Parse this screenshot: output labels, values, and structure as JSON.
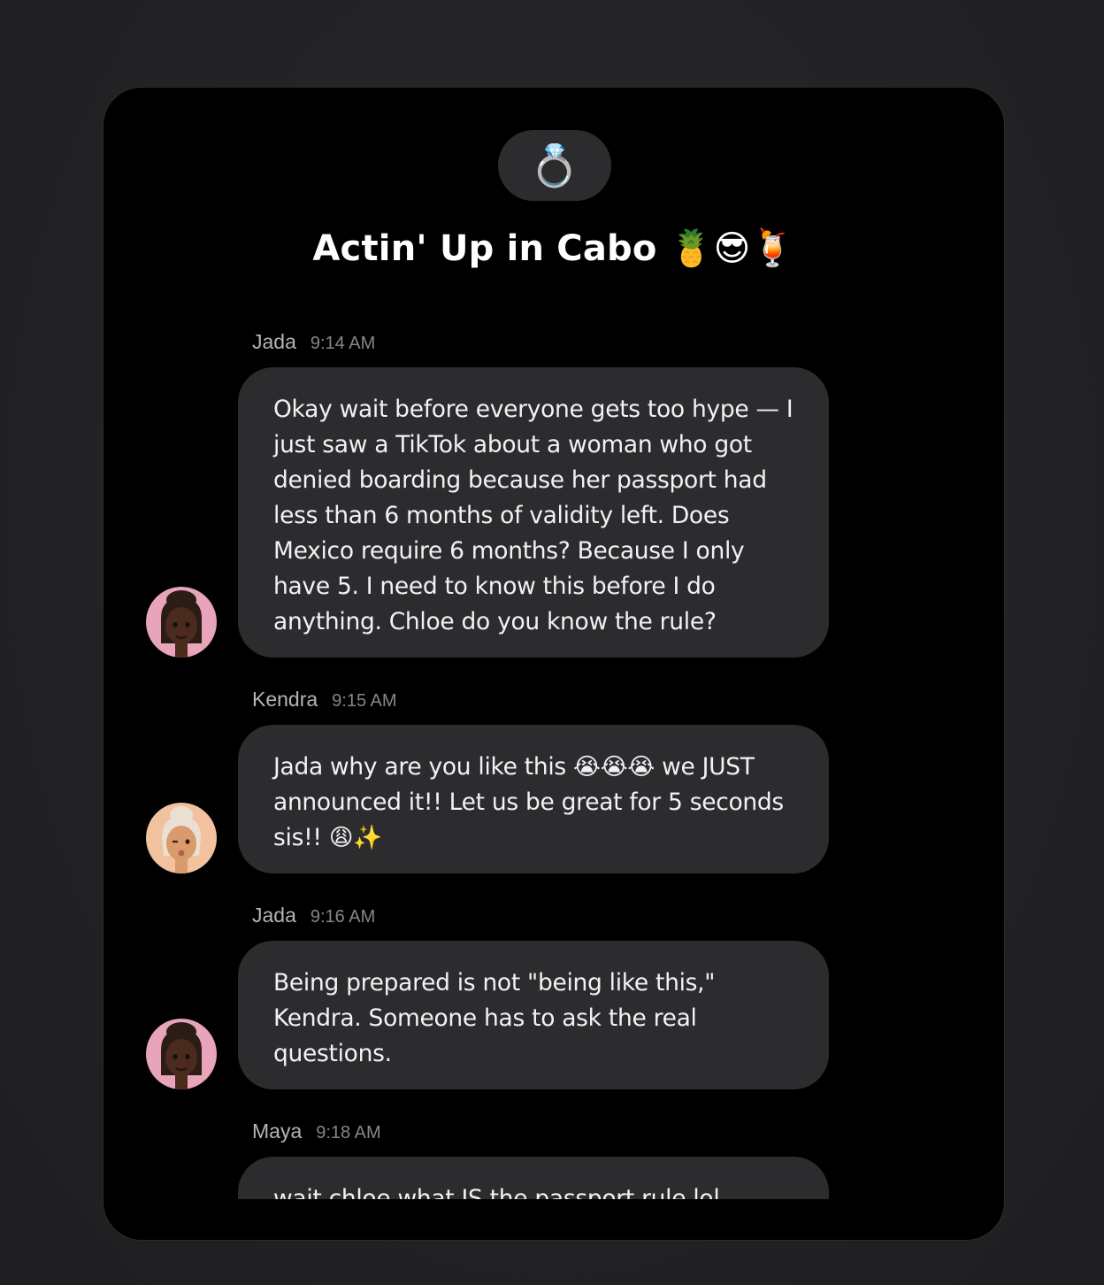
{
  "chat": {
    "group_icon": "💍",
    "group_icon_name": "ring-icon",
    "title": "Actin' Up in Cabo 🍍😎🍹"
  },
  "messages": [
    {
      "sender": "Jada",
      "time": "9:14 AM",
      "avatar": "jada-avatar",
      "avatar_bg": "#e8a4b8",
      "text": "Okay wait before everyone gets too hype — I just saw a TikTok about a woman who got denied boarding because her passport had less than 6 months of validity left. Does Mexico require 6 months? Because I only have 5. I need to know this before I do anything. Chloe do you know the rule?"
    },
    {
      "sender": "Kendra",
      "time": "9:15 AM",
      "avatar": "kendra-avatar",
      "avatar_bg": "#f2c29e",
      "text": "Jada why are you like this 😭😭😭 we JUST announced it!! Let us be great for 5 seconds sis!! 😩✨"
    },
    {
      "sender": "Jada",
      "time": "9:16 AM",
      "avatar": "jada-avatar",
      "avatar_bg": "#e8a4b8",
      "text": "Being prepared is not \"being like this,\" Kendra. Someone has to ask the real questions."
    },
    {
      "sender": "Maya",
      "time": "9:18 AM",
      "text": "wait chloe what IS the passport rule lol"
    }
  ]
}
